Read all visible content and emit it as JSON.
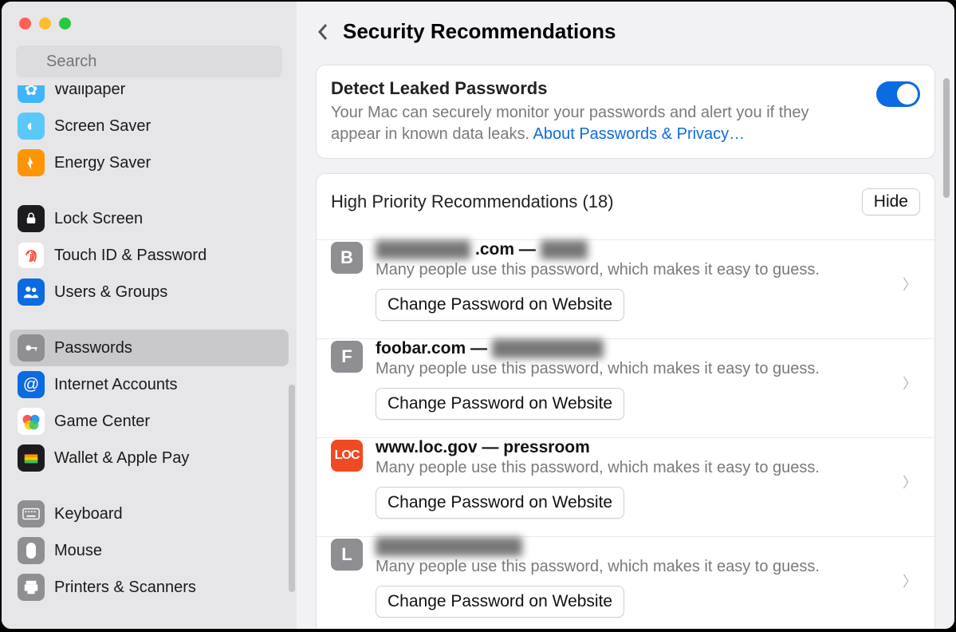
{
  "search": {
    "placeholder": "Search"
  },
  "sidebar": {
    "items": [
      {
        "label": "Wallpaper"
      },
      {
        "label": "Screen Saver"
      },
      {
        "label": "Energy Saver"
      },
      {
        "label": "Lock Screen"
      },
      {
        "label": "Touch ID & Password"
      },
      {
        "label": "Users & Groups"
      },
      {
        "label": "Passwords"
      },
      {
        "label": "Internet Accounts"
      },
      {
        "label": "Game Center"
      },
      {
        "label": "Wallet & Apple Pay"
      },
      {
        "label": "Keyboard"
      },
      {
        "label": "Mouse"
      },
      {
        "label": "Printers & Scanners"
      }
    ]
  },
  "header": {
    "title": "Security Recommendations"
  },
  "detect": {
    "title": "Detect Leaked Passwords",
    "desc": "Your Mac can securely monitor your passwords and alert you if they appear in known data leaks. ",
    "link": "About Passwords & Privacy…",
    "enabled": true
  },
  "high_priority": {
    "title": "High Priority Recommendations (18)",
    "count": 18,
    "hide_label": "Hide",
    "change_label": "Change Password on Website",
    "common_desc": "Many people use this password, which makes it easy to guess.",
    "items": [
      {
        "letter": "B",
        "site_redacted": true,
        "site_suffix": ".com —",
        "username_redacted": true,
        "icon_bg": "#8e8e93"
      },
      {
        "letter": "F",
        "site": "foobar.com —",
        "username_redacted": true,
        "icon_bg": "#8e8e93"
      },
      {
        "letter": "LOC",
        "site": "www.loc.gov — pressroom",
        "icon_bg": "#f04a23",
        "is_loc": true
      },
      {
        "letter": "L",
        "site_redacted": true,
        "username_redacted": true,
        "icon_bg": "#8e8e93"
      }
    ]
  }
}
